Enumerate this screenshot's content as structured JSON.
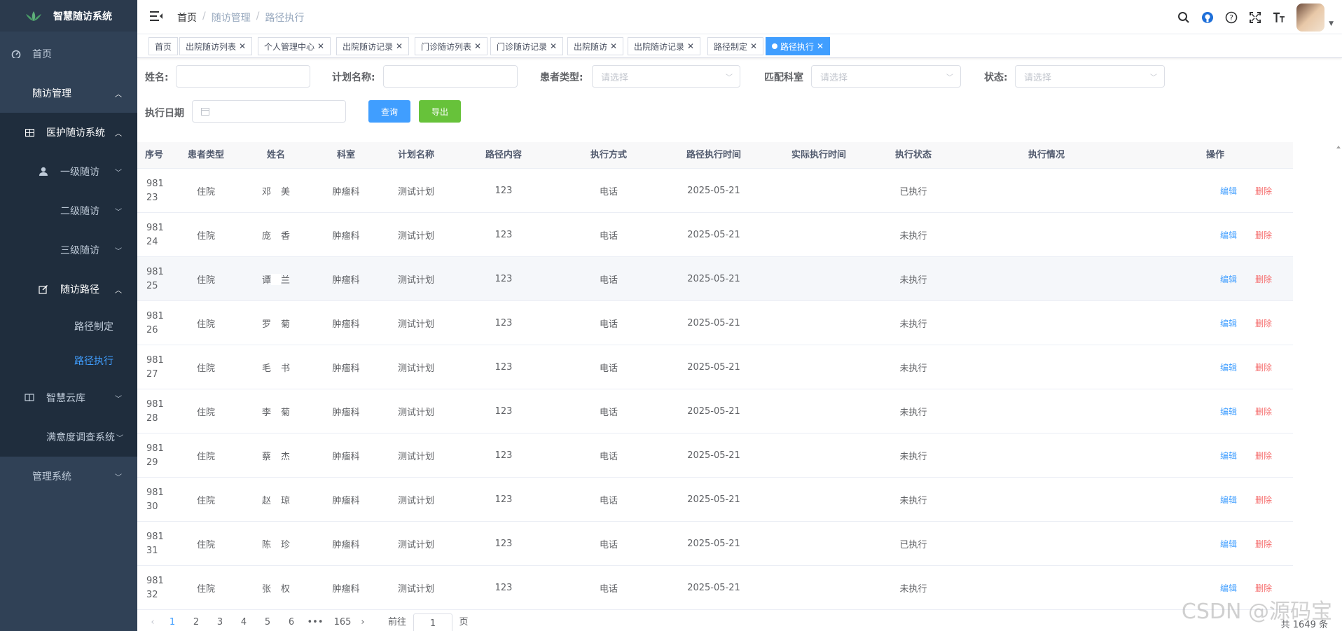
{
  "app": {
    "title": "智慧随访系统"
  },
  "sidebar": {
    "items": [
      {
        "label": "首页"
      },
      {
        "label": "随访管理"
      },
      {
        "label": "医护随访系统"
      },
      {
        "label": "一级随访"
      },
      {
        "label": "二级随访"
      },
      {
        "label": "三级随访"
      },
      {
        "label": "随访路径"
      },
      {
        "label": "路径制定"
      },
      {
        "label": "路径执行"
      },
      {
        "label": "智慧云库"
      },
      {
        "label": "满意度调查系统"
      },
      {
        "label": "管理系统"
      }
    ]
  },
  "breadcrumb": [
    "首页",
    "/",
    "随访管理",
    "/",
    "路径执行"
  ],
  "tags": [
    {
      "label": "首页"
    },
    {
      "label": "出院随访列表"
    },
    {
      "label": "个人管理中心"
    },
    {
      "label": "出院随访记录"
    },
    {
      "label": "门诊随访列表"
    },
    {
      "label": "门诊随访记录"
    },
    {
      "label": "出院随访"
    },
    {
      "label": "出院随访记录"
    },
    {
      "label": "路径制定"
    },
    {
      "label": "路径执行"
    }
  ],
  "form": {
    "name_label": "姓名:",
    "plan_label": "计划名称:",
    "patient_type_label": "患者类型:",
    "patient_type_placeholder": "请选择",
    "dept_label": "匹配科室",
    "dept_placeholder": "请选择",
    "status_label": "状态:",
    "status_placeholder": "请选择",
    "date_label": "执行日期",
    "query_button": "查询",
    "export_button": "导出"
  },
  "table": {
    "columns": [
      "序号",
      "患者类型",
      "姓名",
      "科室",
      "计划名称",
      "路径内容",
      "执行方式",
      "路径执行时间",
      "实际执行时间",
      "执行状态",
      "执行情况",
      "操作"
    ],
    "rows": [
      {
        "seq1": "981",
        "seq2": "23",
        "type": "住院",
        "name_a": "邓",
        "name_b": "美",
        "dept": "肿瘤科",
        "plan": "测试计划",
        "content": "123",
        "method": "电话",
        "time": "2025-05-21",
        "actual": "",
        "status": "已执行",
        "edit": "编辑",
        "del": "删除"
      },
      {
        "seq1": "981",
        "seq2": "24",
        "type": "住院",
        "name_a": "庞",
        "name_b": "香",
        "dept": "肿瘤科",
        "plan": "测试计划",
        "content": "123",
        "method": "电话",
        "time": "2025-05-21",
        "actual": "",
        "status": "未执行",
        "edit": "编辑",
        "del": "删除"
      },
      {
        "seq1": "981",
        "seq2": "25",
        "type": "住院",
        "name_a": "谭",
        "name_b": "兰",
        "dept": "肿瘤科",
        "plan": "测试计划",
        "content": "123",
        "method": "电话",
        "time": "2025-05-21",
        "actual": "",
        "status": "未执行",
        "edit": "编辑",
        "del": "删除"
      },
      {
        "seq1": "981",
        "seq2": "26",
        "type": "住院",
        "name_a": "罗",
        "name_b": "菊",
        "dept": "肿瘤科",
        "plan": "测试计划",
        "content": "123",
        "method": "电话",
        "time": "2025-05-21",
        "actual": "",
        "status": "未执行",
        "edit": "编辑",
        "del": "删除"
      },
      {
        "seq1": "981",
        "seq2": "27",
        "type": "住院",
        "name_a": "毛",
        "name_b": "书",
        "dept": "肿瘤科",
        "plan": "测试计划",
        "content": "123",
        "method": "电话",
        "time": "2025-05-21",
        "actual": "",
        "status": "未执行",
        "edit": "编辑",
        "del": "删除"
      },
      {
        "seq1": "981",
        "seq2": "28",
        "type": "住院",
        "name_a": "李",
        "name_b": "菊",
        "dept": "肿瘤科",
        "plan": "测试计划",
        "content": "123",
        "method": "电话",
        "time": "2025-05-21",
        "actual": "",
        "status": "未执行",
        "edit": "编辑",
        "del": "删除"
      },
      {
        "seq1": "981",
        "seq2": "29",
        "type": "住院",
        "name_a": "蔡",
        "name_b": "杰",
        "dept": "肿瘤科",
        "plan": "测试计划",
        "content": "123",
        "method": "电话",
        "time": "2025-05-21",
        "actual": "",
        "status": "未执行",
        "edit": "编辑",
        "del": "删除"
      },
      {
        "seq1": "981",
        "seq2": "30",
        "type": "住院",
        "name_a": "赵",
        "name_b": "琼",
        "dept": "肿瘤科",
        "plan": "测试计划",
        "content": "123",
        "method": "电话",
        "time": "2025-05-21",
        "actual": "",
        "status": "未执行",
        "edit": "编辑",
        "del": "删除"
      },
      {
        "seq1": "981",
        "seq2": "31",
        "type": "住院",
        "name_a": "陈",
        "name_b": "珍",
        "dept": "肿瘤科",
        "plan": "测试计划",
        "content": "123",
        "method": "电话",
        "time": "2025-05-21",
        "actual": "",
        "status": "已执行",
        "edit": "编辑",
        "del": "删除"
      },
      {
        "seq1": "981",
        "seq2": "32",
        "type": "住院",
        "name_a": "张",
        "name_b": "权",
        "dept": "肿瘤科",
        "plan": "测试计划",
        "content": "123",
        "method": "电话",
        "time": "2025-05-21",
        "actual": "",
        "status": "未执行",
        "edit": "编辑",
        "del": "删除"
      }
    ]
  },
  "pagination": {
    "prev": "‹",
    "pages": [
      "1",
      "2",
      "3",
      "4",
      "5",
      "6",
      "•••",
      "165"
    ],
    "next": "›",
    "goto_label": "前往",
    "goto_value": "1",
    "page_unit": "页",
    "total": "共 1649 条"
  },
  "watermark": "CSDN @源码宝",
  "colors": {
    "sidebar": "#304156",
    "accent": "#409eff",
    "export": "#67c23a",
    "danger": "#f56c6c"
  }
}
